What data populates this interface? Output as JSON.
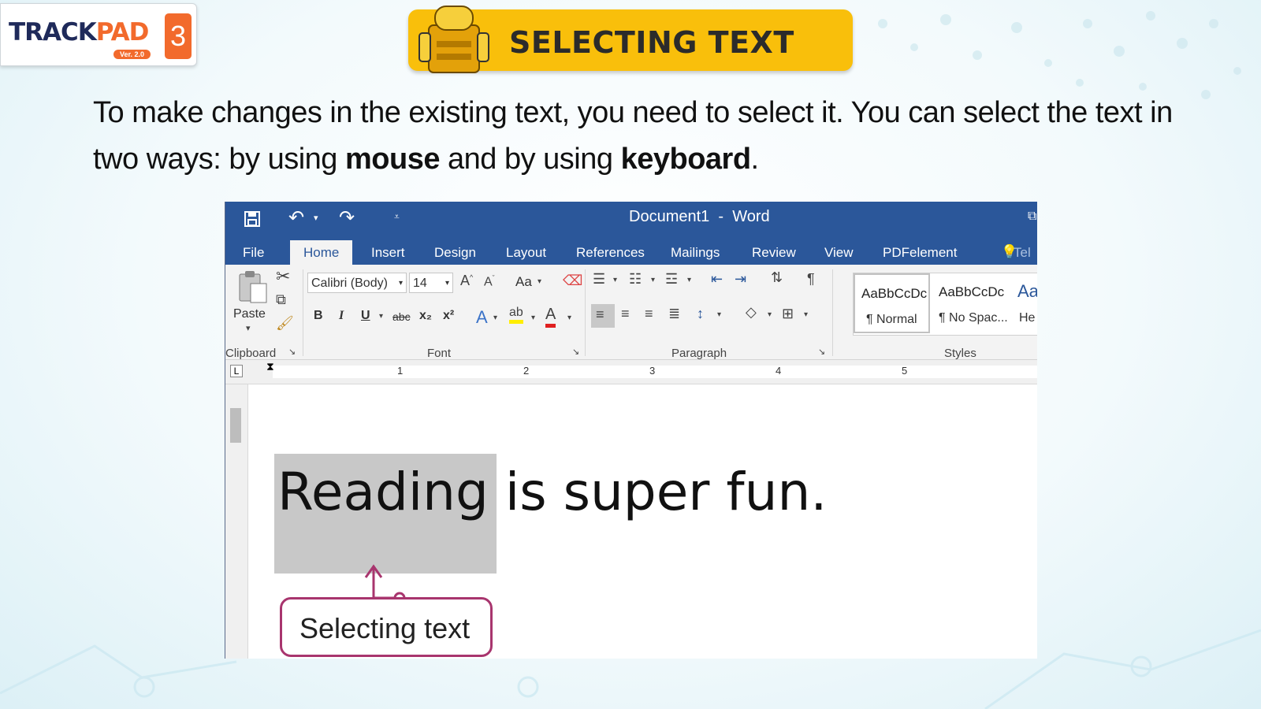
{
  "logo": {
    "brand_main": "TRACK",
    "brand_accent": "PAD",
    "number": "3",
    "version": "Ver. 2.0"
  },
  "title": "SELECTING TEXT",
  "intro": {
    "part1": "To make changes in the existing text, you need to select it. You can select the text in two ways: by using ",
    "bold1": "mouse",
    "part2": " and by using ",
    "bold2": "keyboard",
    "part3": "."
  },
  "word": {
    "title_doc": "Document1",
    "title_sep": "-",
    "title_app": "Word",
    "tabs": [
      "File",
      "Home",
      "Insert",
      "Design",
      "Layout",
      "References",
      "Mailings",
      "Review",
      "View",
      "PDFelement",
      "Tel"
    ],
    "active_tab": "Home",
    "clipboard": {
      "paste_label": "Paste",
      "group_label": "Clipboard"
    },
    "font": {
      "font_name": "Calibri (Body)",
      "font_size": "14",
      "change_case": "Aa",
      "group_label": "Font",
      "bold": "B",
      "italic": "I",
      "underline": "U",
      "strike": "abc",
      "subscript": "x₂",
      "superscript": "x²"
    },
    "paragraph": {
      "group_label": "Paragraph"
    },
    "styles": {
      "group_label": "Styles",
      "items": [
        {
          "sample": "AaBbCcDc",
          "name": "¶ Normal"
        },
        {
          "sample": "AaBbCcDc",
          "name": "¶ No Spac..."
        },
        {
          "sample": "Aa",
          "name": "He"
        }
      ]
    },
    "ruler_numbers": [
      "1",
      "2",
      "3",
      "4",
      "5"
    ],
    "document": {
      "selected_word": "Reading",
      "rest_text": " is super fun."
    }
  },
  "callout": {
    "label": "Selecting text"
  },
  "colors": {
    "word_blue": "#2b579a",
    "banner_yellow": "#f9bf0b",
    "callout_border": "#a8356e",
    "brand_orange": "#f26a2c"
  }
}
